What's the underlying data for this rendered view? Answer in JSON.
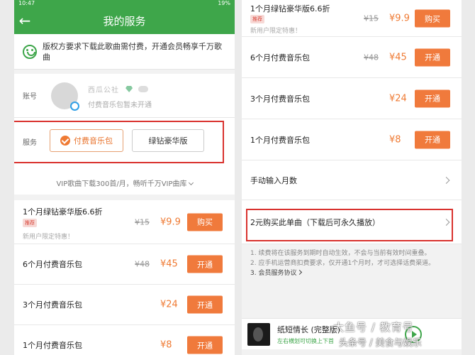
{
  "left": {
    "statusbar": {
      "time": "10:47",
      "battery": "19%"
    },
    "header": {
      "title": "我的服务"
    },
    "notice": {
      "text": "版权方要求下载此歌曲需付费，开通会员畅享千万歌曲"
    },
    "account": {
      "label": "账号",
      "name": "西瓜公社",
      "status": "付费音乐包暂未开通"
    },
    "service": {
      "label": "服务",
      "options": [
        "付费音乐包",
        "绿钻豪华版"
      ],
      "note": "VIP歌曲下载300首/月，畅听千万VIP曲库"
    },
    "plans": [
      {
        "name": "1个月绿钻豪华版6.6折",
        "tag": "推荐",
        "subtitle": "新用户限定特惠！",
        "old_price": "¥15",
        "price": "¥9.9",
        "button": "购买"
      },
      {
        "name": "6个月付费音乐包",
        "old_price": "¥48",
        "price": "¥45",
        "button": "开通"
      },
      {
        "name": "3个月付费音乐包",
        "old_price": "",
        "price": "¥24",
        "button": "开通"
      },
      {
        "name": "1个月付费音乐包",
        "old_price": "",
        "price": "¥8",
        "button": "开通"
      }
    ]
  },
  "right": {
    "plans": [
      {
        "name": "1个月绿钻豪华版6.6折",
        "tag": "推荐",
        "subtitle": "新用户限定特惠！",
        "old_price": "¥15",
        "price": "¥9.9",
        "button": "购买"
      },
      {
        "name": "6个月付费音乐包",
        "old_price": "¥48",
        "price": "¥45",
        "button": "开通"
      },
      {
        "name": "3个月付费音乐包",
        "old_price": "",
        "price": "¥24",
        "button": "开通"
      },
      {
        "name": "1个月付费音乐包",
        "old_price": "",
        "price": "¥8",
        "button": "开通"
      }
    ],
    "manual_months": "手动输入月数",
    "single_purchase": "2元购买此单曲（下载后可永久播放）",
    "notes": [
      "1. 续费将在该服务到期时自动生效，不会与当前有效时间重叠。",
      "2. 应手机运营商扣费要求，仅开通1个月时，才可选择话费渠道。"
    ],
    "agreement": "3. 会员服务协议",
    "player": {
      "title": "纸短情长 (完整版)",
      "subtitle": "左右横划可切换上下首"
    }
  },
  "watermark": {
    "line1": "大鱼号 / 教育号",
    "line2": "头条号 / 美食与娱乐"
  },
  "colors": {
    "brand_green": "#3ea64a",
    "accent_orange": "#f07a3c",
    "frame_red": "#d9322e"
  }
}
